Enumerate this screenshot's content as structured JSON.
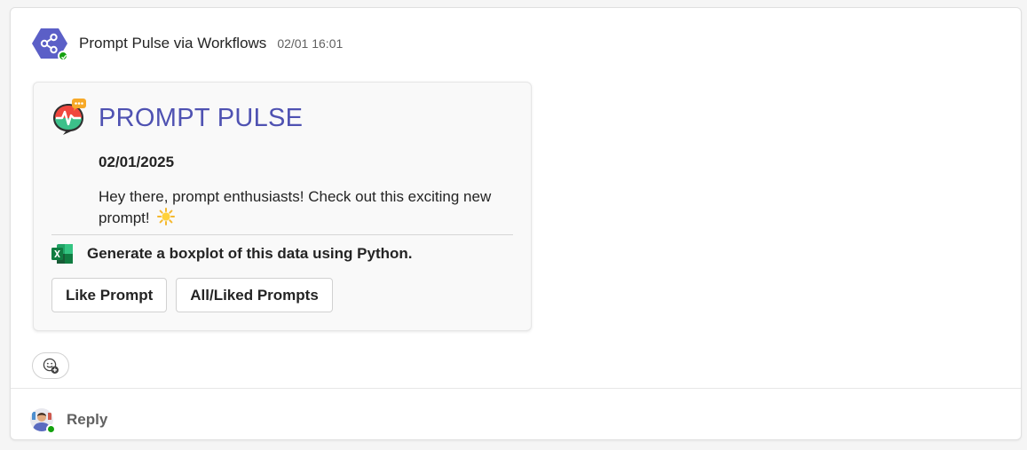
{
  "message": {
    "sender": "Prompt Pulse via Workflows",
    "timestamp": "02/01 16:01",
    "sender_icon": "workflow-share-icon",
    "presence_color": "#13a10e"
  },
  "card": {
    "title": "PROMPT PULSE",
    "date": "02/01/2025",
    "body": "Hey there, prompt enthusiasts! Check out this exciting new prompt!",
    "body_emoji": "sun-emoji",
    "prompt_icon": "excel-icon",
    "prompt_text": "Generate a boxplot of this data using Python.",
    "actions": [
      {
        "label": "Like Prompt"
      },
      {
        "label": "All/Liked Prompts"
      }
    ],
    "title_color": "#4f52b2"
  },
  "footer": {
    "reaction_icon": "add-reaction-icon",
    "reply_label": "Reply"
  }
}
